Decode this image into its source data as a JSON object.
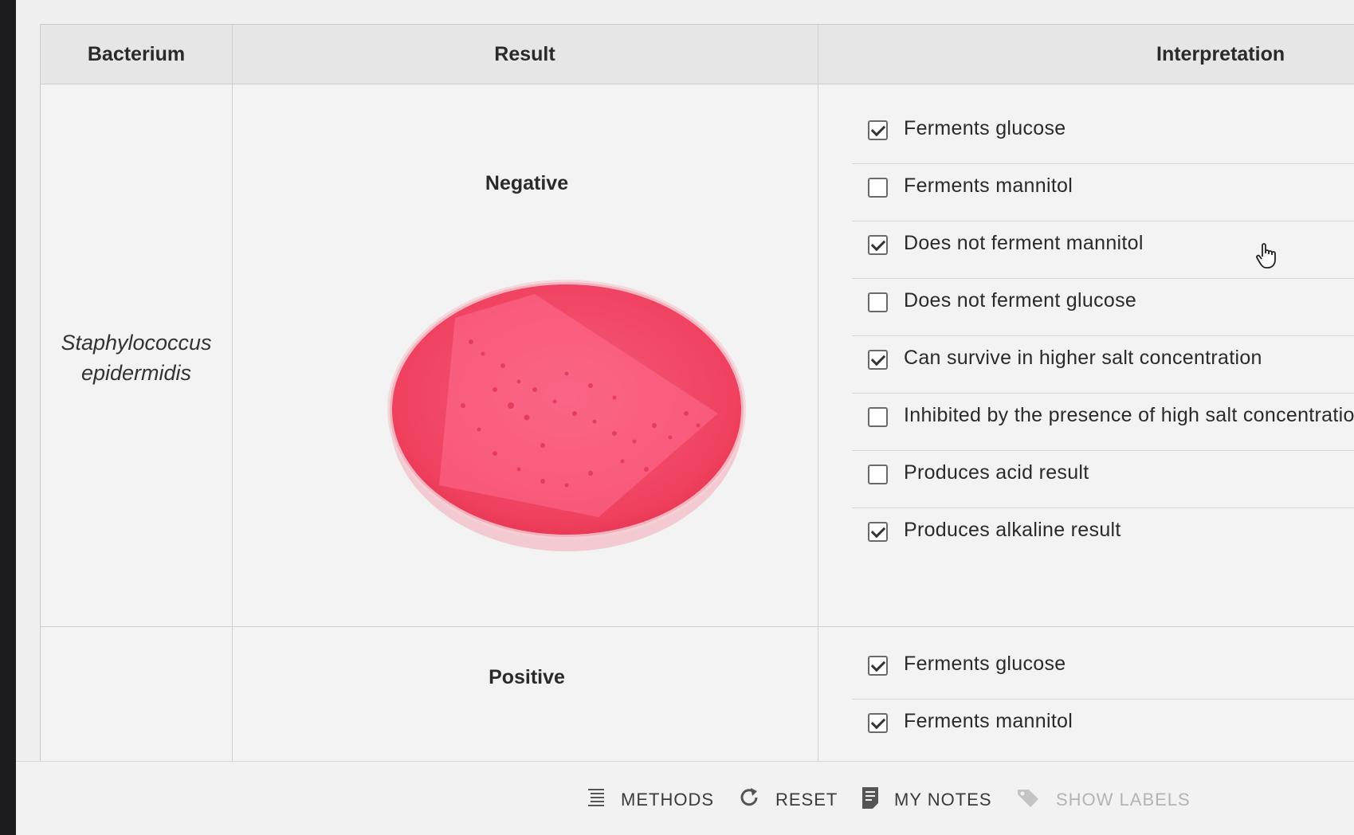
{
  "table": {
    "headers": {
      "bacterium": "Bacterium",
      "result": "Result",
      "interpretation": "Interpretation"
    },
    "rows": [
      {
        "bacterium": "Staphylococcus epidermidis",
        "result": "Negative",
        "plate_color": "#f2496a",
        "options": [
          {
            "label": "Ferments glucose",
            "checked": true
          },
          {
            "label": "Ferments mannitol",
            "checked": false
          },
          {
            "label": "Does not ferment mannitol",
            "checked": true
          },
          {
            "label": "Does not ferment glucose",
            "checked": false
          },
          {
            "label": "Can survive in higher salt concentration",
            "checked": true
          },
          {
            "label": "Inhibited by the presence of high salt concentratio",
            "checked": false
          },
          {
            "label": "Produces acid result",
            "checked": false
          },
          {
            "label": "Produces alkaline result",
            "checked": true
          }
        ]
      },
      {
        "bacterium": "",
        "result": "Positive",
        "options": [
          {
            "label": "Ferments glucose",
            "checked": true
          },
          {
            "label": "Ferments mannitol",
            "checked": true
          }
        ]
      }
    ]
  },
  "toolbar": {
    "methods": "METHODS",
    "reset": "RESET",
    "my_notes": "MY NOTES",
    "show_labels": "SHOW LABELS"
  },
  "colors": {
    "header_bg": "#e6e6e6",
    "agar": "#f2496a",
    "disabled_text": "#b4b4b4"
  }
}
